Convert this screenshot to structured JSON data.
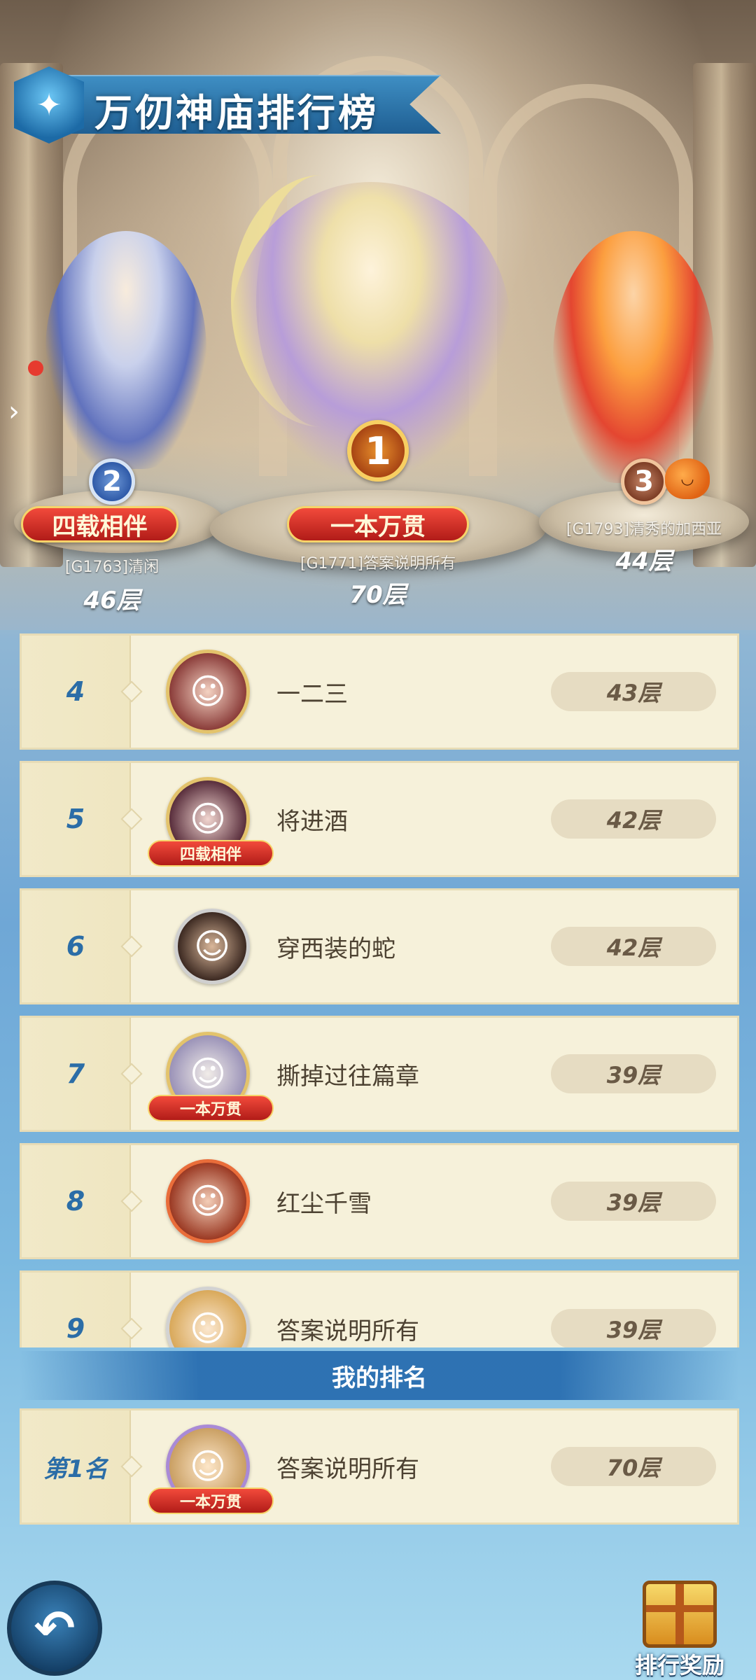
{
  "header": {
    "title": "万仞神庙排行榜"
  },
  "podium": [
    {
      "rank": "1",
      "title_tag": "一本万贯",
      "name": "[G1771]答案说明所有",
      "floor": "70层"
    },
    {
      "rank": "2",
      "title_tag": "四载相伴",
      "name": "[G1763]清闲",
      "floor": "46层"
    },
    {
      "rank": "3",
      "title_tag": "",
      "name": "[G1793]清秀的加西亚",
      "floor": "44层"
    }
  ],
  "list": [
    {
      "rank": "4",
      "name": "一二三",
      "floor": "43层",
      "tag": ""
    },
    {
      "rank": "5",
      "name": "将进酒",
      "floor": "42层",
      "tag": "四载相伴"
    },
    {
      "rank": "6",
      "name": "穿西装的蛇",
      "floor": "42层",
      "tag": ""
    },
    {
      "rank": "7",
      "name": "撕掉过往篇章",
      "floor": "39层",
      "tag": "一本万贯"
    },
    {
      "rank": "8",
      "name": "红尘千雪",
      "floor": "39层",
      "tag": ""
    },
    {
      "rank": "9",
      "name": "答案说明所有",
      "floor": "39层",
      "tag": ""
    }
  ],
  "my_rank": {
    "header": "我的排名",
    "rank": "第1名",
    "name": "答案说明所有",
    "floor": "70层",
    "tag": "一本万贯"
  },
  "controls": {
    "reward_label": "排行奖励"
  },
  "colors": {
    "rank_text": "#2b6da7",
    "row_bg": "#f6f1da",
    "tag_red": "#d22f25"
  },
  "icons": {
    "back": "back-arrow-icon",
    "reward": "gift-box-icon",
    "title": "shield-badge-icon"
  }
}
